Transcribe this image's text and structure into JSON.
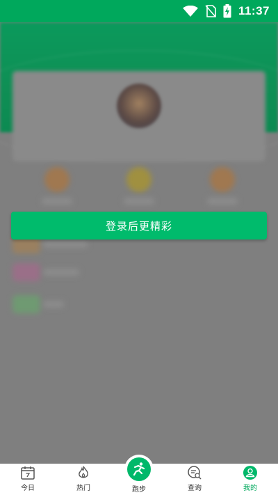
{
  "status_bar": {
    "time": "11:37"
  },
  "login_banner": {
    "label": "登录后更精彩"
  },
  "bottom_nav": {
    "items": [
      {
        "label": "今日",
        "icon": "calendar-icon",
        "active": false
      },
      {
        "label": "热门",
        "icon": "flame-icon",
        "active": false
      },
      {
        "label": "跑步",
        "icon": "runner-icon",
        "active": false
      },
      {
        "label": "查询",
        "icon": "search-list-icon",
        "active": false
      },
      {
        "label": "我的",
        "icon": "user-icon",
        "active": true
      }
    ]
  },
  "colors": {
    "brand_green": "#00bb6c",
    "status_bar": "#00a85c",
    "overlay": "#7f7f7f"
  }
}
